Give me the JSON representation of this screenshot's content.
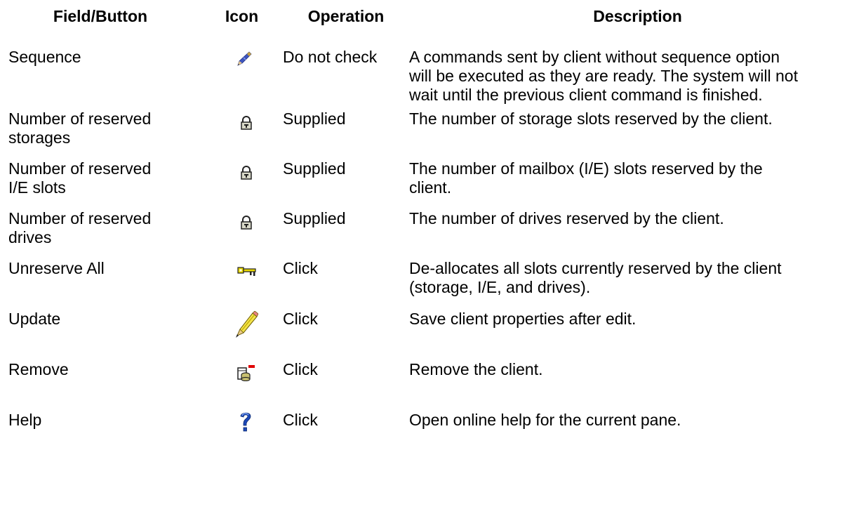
{
  "headers": {
    "field": "Field/Button",
    "icon": "Icon",
    "operation": "Operation",
    "description": "Description"
  },
  "rows": [
    {
      "field": "Sequence",
      "icon": "wand-pencil-icon",
      "operation": "Do not check",
      "description_lines": [
        "A commands sent by client without sequence option",
        "will be executed as they are ready. The system will not",
        "wait until the previous client command is finished."
      ]
    },
    {
      "field_lines": [
        "Number of reserved",
        "storages"
      ],
      "icon": "lock-icon",
      "operation": "Supplied",
      "description_lines": [
        "The number of storage slots reserved by the client."
      ]
    },
    {
      "field_lines": [
        "Number of reserved",
        "I/E slots"
      ],
      "icon": "lock-icon",
      "operation": "Supplied",
      "description_lines": [
        "The number of mailbox (I/E) slots reserved by the",
        "client."
      ]
    },
    {
      "field_lines": [
        "Number of reserved",
        "drives"
      ],
      "icon": "lock-icon",
      "operation": "Supplied",
      "description_lines": [
        "The number of drives reserved by the client."
      ]
    },
    {
      "field": "Unreserve All",
      "icon": "key-icon",
      "operation": "Click",
      "description_lines": [
        "De-allocates all slots currently reserved by the client",
        "(storage, I/E, and drives)."
      ]
    },
    {
      "field": "Update",
      "icon": "pencil-icon",
      "operation": "Click",
      "description_lines": [
        "Save client properties after edit."
      ]
    },
    {
      "field": "Remove",
      "icon": "remove-client-icon",
      "operation": "Click",
      "description_lines": [
        "Remove the client."
      ]
    },
    {
      "field": "Help",
      "icon": "question-mark-icon",
      "operation": "Click",
      "description_lines": [
        "Open online help for the current pane."
      ]
    }
  ],
  "colors": {
    "text": "#000000",
    "background": "#ffffff",
    "lock_body": "#d8d8c8",
    "key_gold": "#e8d800",
    "pencil_yellow": "#f2e34a",
    "help_blue": "#1c48b8",
    "remove_red": "#e00000"
  }
}
